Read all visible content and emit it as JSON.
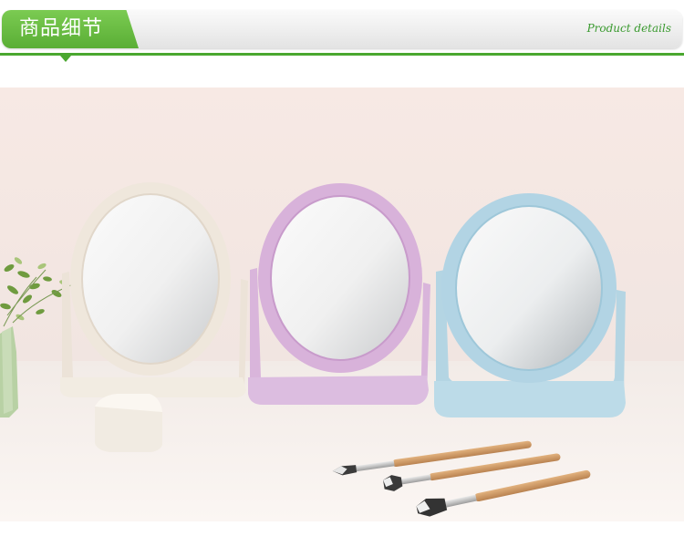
{
  "header": {
    "title": "商品细节",
    "subtitle": "Product details"
  },
  "colors": {
    "accent": "#4aa72f",
    "tab_top": "#7bcb52",
    "tab_bottom": "#5aae35"
  }
}
